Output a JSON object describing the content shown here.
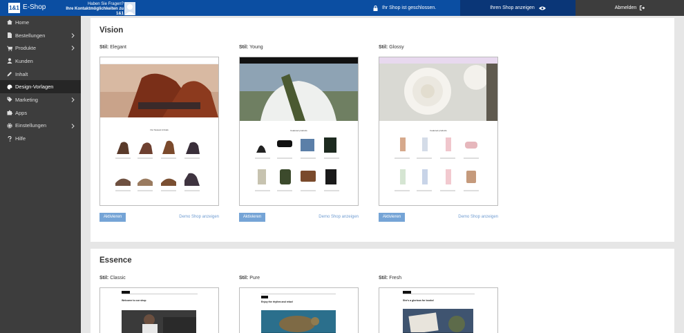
{
  "topbar": {
    "logo_text": "1&1",
    "app_name": "E-Shop",
    "help_line1": "Haben Sie Fragen?",
    "help_line2": "Ihre Kontaktmöglichkeiten zu 1&1",
    "shop_status": "Ihr Shop ist geschlossen.",
    "view_shop": "Ihren Shop anzeigen",
    "logout": "Abmelden"
  },
  "sidebar": {
    "items": [
      {
        "label": "Home",
        "icon": "home-icon",
        "chevron": false
      },
      {
        "label": "Bestellungen",
        "icon": "document-icon",
        "chevron": true
      },
      {
        "label": "Produkte",
        "icon": "cart-icon",
        "chevron": true
      },
      {
        "label": "Kunden",
        "icon": "user-icon",
        "chevron": false
      },
      {
        "label": "Inhalt",
        "icon": "pencil-icon",
        "chevron": false
      },
      {
        "label": "Design-Vorlagen",
        "icon": "palette-icon",
        "chevron": false,
        "active": true
      },
      {
        "label": "Marketing",
        "icon": "tag-icon",
        "chevron": true
      },
      {
        "label": "Apps",
        "icon": "puzzle-icon",
        "chevron": false
      },
      {
        "label": "Einstellungen",
        "icon": "gear-icon",
        "chevron": true
      },
      {
        "label": "Hilfe",
        "icon": "question-icon",
        "chevron": false
      }
    ]
  },
  "sections": [
    {
      "title": "Vision",
      "styles": [
        {
          "prefix": "Stil:",
          "name": "Elegant",
          "activate": "Aktivieren",
          "demo": "Demo Shop anzeigen",
          "shop_heading": "Our Newest Arrivals"
        },
        {
          "prefix": "Stil:",
          "name": "Young",
          "activate": "Aktivieren",
          "demo": "Demo Shop anzeigen",
          "shop_heading": "Featured products"
        },
        {
          "prefix": "Stil:",
          "name": "Glossy",
          "activate": "Aktivieren",
          "demo": "Demo Shop anzeigen",
          "shop_heading": "Featured products"
        }
      ]
    },
    {
      "title": "Essence",
      "styles": [
        {
          "prefix": "Stil:",
          "name": "Classic",
          "shop_heading": "Welcome to our shop"
        },
        {
          "prefix": "Stil:",
          "name": "Pure",
          "shop_heading": "Enjoy the rhythm and relax!"
        },
        {
          "prefix": "Stil:",
          "name": "Fresh",
          "shop_heading": "She's a glorious for books!"
        }
      ]
    }
  ],
  "colors": {
    "topbar": "#0b4ea2",
    "view_button": "#0a3677",
    "sidebar": "#3d3d3d",
    "activate_button": "#75a4d6",
    "demo_link": "#6e9bd0"
  }
}
